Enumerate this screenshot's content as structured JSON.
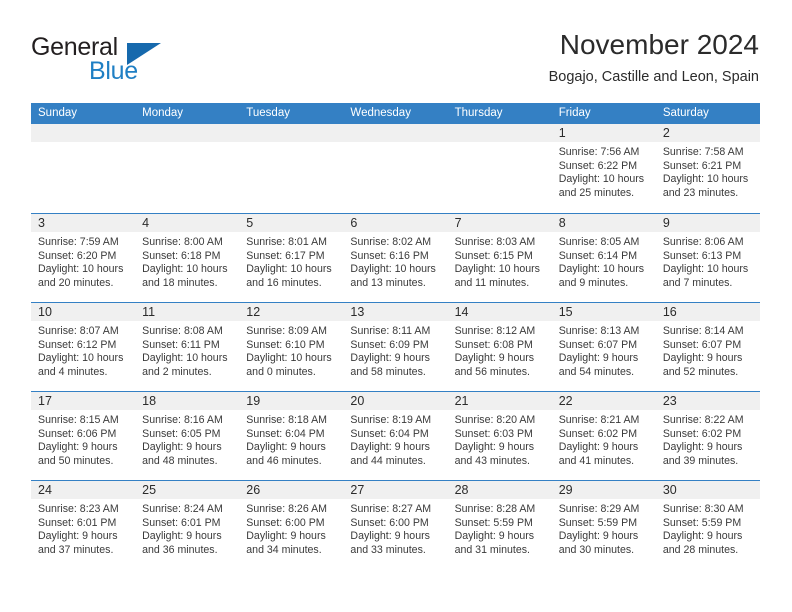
{
  "brand": {
    "name_part1": "General",
    "name_part2": "Blue",
    "triangle_icon": "triangle-icon",
    "accent_color": "#1f7fc4"
  },
  "header": {
    "title": "November 2024",
    "location": "Bogajo, Castille and Leon, Spain"
  },
  "theme": {
    "header_blue": "#3480c4",
    "daynum_band_gray": "#f0f0f0",
    "text_color": "#2b2b2b"
  },
  "calendar": {
    "weekdays": [
      "Sunday",
      "Monday",
      "Tuesday",
      "Wednesday",
      "Thursday",
      "Friday",
      "Saturday"
    ],
    "weeks": [
      [
        {
          "day": "",
          "sunrise": "",
          "sunset": "",
          "daylight": "",
          "empty": true
        },
        {
          "day": "",
          "sunrise": "",
          "sunset": "",
          "daylight": "",
          "empty": true
        },
        {
          "day": "",
          "sunrise": "",
          "sunset": "",
          "daylight": "",
          "empty": true
        },
        {
          "day": "",
          "sunrise": "",
          "sunset": "",
          "daylight": "",
          "empty": true
        },
        {
          "day": "",
          "sunrise": "",
          "sunset": "",
          "daylight": "",
          "empty": true
        },
        {
          "day": "1",
          "sunrise": "Sunrise: 7:56 AM",
          "sunset": "Sunset: 6:22 PM",
          "daylight": "Daylight: 10 hours and 25 minutes."
        },
        {
          "day": "2",
          "sunrise": "Sunrise: 7:58 AM",
          "sunset": "Sunset: 6:21 PM",
          "daylight": "Daylight: 10 hours and 23 minutes."
        }
      ],
      [
        {
          "day": "3",
          "sunrise": "Sunrise: 7:59 AM",
          "sunset": "Sunset: 6:20 PM",
          "daylight": "Daylight: 10 hours and 20 minutes."
        },
        {
          "day": "4",
          "sunrise": "Sunrise: 8:00 AM",
          "sunset": "Sunset: 6:18 PM",
          "daylight": "Daylight: 10 hours and 18 minutes."
        },
        {
          "day": "5",
          "sunrise": "Sunrise: 8:01 AM",
          "sunset": "Sunset: 6:17 PM",
          "daylight": "Daylight: 10 hours and 16 minutes."
        },
        {
          "day": "6",
          "sunrise": "Sunrise: 8:02 AM",
          "sunset": "Sunset: 6:16 PM",
          "daylight": "Daylight: 10 hours and 13 minutes."
        },
        {
          "day": "7",
          "sunrise": "Sunrise: 8:03 AM",
          "sunset": "Sunset: 6:15 PM",
          "daylight": "Daylight: 10 hours and 11 minutes."
        },
        {
          "day": "8",
          "sunrise": "Sunrise: 8:05 AM",
          "sunset": "Sunset: 6:14 PM",
          "daylight": "Daylight: 10 hours and 9 minutes."
        },
        {
          "day": "9",
          "sunrise": "Sunrise: 8:06 AM",
          "sunset": "Sunset: 6:13 PM",
          "daylight": "Daylight: 10 hours and 7 minutes."
        }
      ],
      [
        {
          "day": "10",
          "sunrise": "Sunrise: 8:07 AM",
          "sunset": "Sunset: 6:12 PM",
          "daylight": "Daylight: 10 hours and 4 minutes."
        },
        {
          "day": "11",
          "sunrise": "Sunrise: 8:08 AM",
          "sunset": "Sunset: 6:11 PM",
          "daylight": "Daylight: 10 hours and 2 minutes."
        },
        {
          "day": "12",
          "sunrise": "Sunrise: 8:09 AM",
          "sunset": "Sunset: 6:10 PM",
          "daylight": "Daylight: 10 hours and 0 minutes."
        },
        {
          "day": "13",
          "sunrise": "Sunrise: 8:11 AM",
          "sunset": "Sunset: 6:09 PM",
          "daylight": "Daylight: 9 hours and 58 minutes."
        },
        {
          "day": "14",
          "sunrise": "Sunrise: 8:12 AM",
          "sunset": "Sunset: 6:08 PM",
          "daylight": "Daylight: 9 hours and 56 minutes."
        },
        {
          "day": "15",
          "sunrise": "Sunrise: 8:13 AM",
          "sunset": "Sunset: 6:07 PM",
          "daylight": "Daylight: 9 hours and 54 minutes."
        },
        {
          "day": "16",
          "sunrise": "Sunrise: 8:14 AM",
          "sunset": "Sunset: 6:07 PM",
          "daylight": "Daylight: 9 hours and 52 minutes."
        }
      ],
      [
        {
          "day": "17",
          "sunrise": "Sunrise: 8:15 AM",
          "sunset": "Sunset: 6:06 PM",
          "daylight": "Daylight: 9 hours and 50 minutes."
        },
        {
          "day": "18",
          "sunrise": "Sunrise: 8:16 AM",
          "sunset": "Sunset: 6:05 PM",
          "daylight": "Daylight: 9 hours and 48 minutes."
        },
        {
          "day": "19",
          "sunrise": "Sunrise: 8:18 AM",
          "sunset": "Sunset: 6:04 PM",
          "daylight": "Daylight: 9 hours and 46 minutes."
        },
        {
          "day": "20",
          "sunrise": "Sunrise: 8:19 AM",
          "sunset": "Sunset: 6:04 PM",
          "daylight": "Daylight: 9 hours and 44 minutes."
        },
        {
          "day": "21",
          "sunrise": "Sunrise: 8:20 AM",
          "sunset": "Sunset: 6:03 PM",
          "daylight": "Daylight: 9 hours and 43 minutes."
        },
        {
          "day": "22",
          "sunrise": "Sunrise: 8:21 AM",
          "sunset": "Sunset: 6:02 PM",
          "daylight": "Daylight: 9 hours and 41 minutes."
        },
        {
          "day": "23",
          "sunrise": "Sunrise: 8:22 AM",
          "sunset": "Sunset: 6:02 PM",
          "daylight": "Daylight: 9 hours and 39 minutes."
        }
      ],
      [
        {
          "day": "24",
          "sunrise": "Sunrise: 8:23 AM",
          "sunset": "Sunset: 6:01 PM",
          "daylight": "Daylight: 9 hours and 37 minutes."
        },
        {
          "day": "25",
          "sunrise": "Sunrise: 8:24 AM",
          "sunset": "Sunset: 6:01 PM",
          "daylight": "Daylight: 9 hours and 36 minutes."
        },
        {
          "day": "26",
          "sunrise": "Sunrise: 8:26 AM",
          "sunset": "Sunset: 6:00 PM",
          "daylight": "Daylight: 9 hours and 34 minutes."
        },
        {
          "day": "27",
          "sunrise": "Sunrise: 8:27 AM",
          "sunset": "Sunset: 6:00 PM",
          "daylight": "Daylight: 9 hours and 33 minutes."
        },
        {
          "day": "28",
          "sunrise": "Sunrise: 8:28 AM",
          "sunset": "Sunset: 5:59 PM",
          "daylight": "Daylight: 9 hours and 31 minutes."
        },
        {
          "day": "29",
          "sunrise": "Sunrise: 8:29 AM",
          "sunset": "Sunset: 5:59 PM",
          "daylight": "Daylight: 9 hours and 30 minutes."
        },
        {
          "day": "30",
          "sunrise": "Sunrise: 8:30 AM",
          "sunset": "Sunset: 5:59 PM",
          "daylight": "Daylight: 9 hours and 28 minutes."
        }
      ]
    ]
  }
}
